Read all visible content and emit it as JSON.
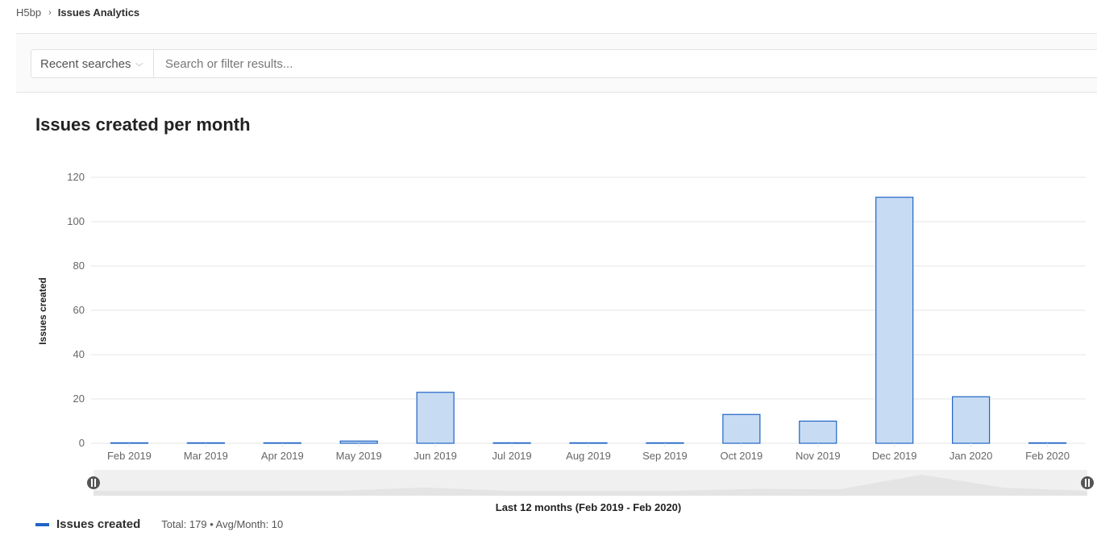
{
  "breadcrumb": {
    "parent": "H5bp",
    "separator_icon": "chevron-right-icon",
    "current": "Issues Analytics"
  },
  "filter": {
    "recent_searches_label": "Recent searches",
    "recent_searches_icon": "chevron-down-icon",
    "search_placeholder": "Search or filter results...",
    "search_value": ""
  },
  "colors": {
    "bar_fill": "#c7dbf3",
    "bar_stroke": "#1f64c5",
    "grid": "#e5e5e5",
    "axis_text": "#666666",
    "slider_bg": "#f0f0f0",
    "slider_area": "#e4e4e4",
    "handle": "#555555"
  },
  "chart_data": {
    "type": "bar",
    "title": "Issues created per month",
    "xlabel": "Last 12 months (Feb 2019 - Feb 2020)",
    "ylabel": "Issues created",
    "ylim": [
      0,
      120
    ],
    "yticks": [
      0,
      20,
      40,
      60,
      80,
      100,
      120
    ],
    "grid": true,
    "categories": [
      "Feb 2019",
      "Mar 2019",
      "Apr 2019",
      "May 2019",
      "Jun 2019",
      "Jul 2019",
      "Aug 2019",
      "Sep 2019",
      "Oct 2019",
      "Nov 2019",
      "Dec 2019",
      "Jan 2020",
      "Feb 2020"
    ],
    "series": [
      {
        "name": "Issues created",
        "values": [
          0,
          0,
          0,
          1,
          23,
          0,
          0,
          0,
          13,
          10,
          111,
          21,
          0
        ]
      }
    ],
    "legend": {
      "position": "bottom-left",
      "entries": [
        "Issues created"
      ],
      "stats": "Total: 179 • Avg/Month: 10"
    },
    "zoom_slider": {
      "start_fraction": 0,
      "end_fraction": 1
    }
  }
}
